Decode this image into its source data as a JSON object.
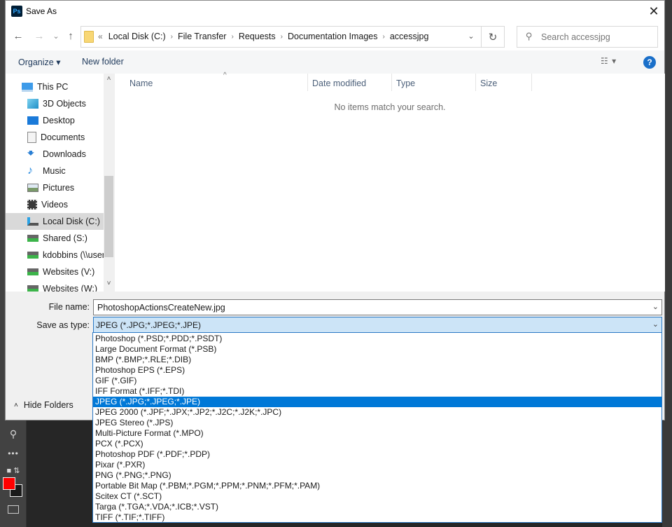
{
  "window": {
    "title": "Save As",
    "app_icon_label": "Ps"
  },
  "nav": {
    "back": "←",
    "forward": "→",
    "recent": "⌄",
    "up": "↑",
    "overflow": "«",
    "breadcrumbs": [
      "Local Disk (C:)",
      "File Transfer",
      "Requests",
      "Documentation Images",
      "accessjpg"
    ],
    "breadcrumb_separator": "›",
    "refresh": "↻",
    "search_placeholder": "Search accessjpg"
  },
  "commandbar": {
    "organize": "Organize ▾",
    "new_folder": "New folder",
    "view_icon": "☷ ▾",
    "help": "?"
  },
  "sidebar": {
    "items": [
      {
        "label": "This PC",
        "icon": "computer-icon",
        "selected": false
      },
      {
        "label": "3D Objects",
        "icon": "cube-icon",
        "selected": false
      },
      {
        "label": "Desktop",
        "icon": "desktop-icon",
        "selected": false
      },
      {
        "label": "Documents",
        "icon": "document-icon",
        "selected": false
      },
      {
        "label": "Downloads",
        "icon": "download-icon",
        "selected": false
      },
      {
        "label": "Music",
        "icon": "music-note-icon",
        "selected": false
      },
      {
        "label": "Pictures",
        "icon": "picture-icon",
        "selected": false
      },
      {
        "label": "Videos",
        "icon": "film-icon",
        "selected": false
      },
      {
        "label": "Local Disk (C:)",
        "icon": "drive-icon",
        "selected": true
      },
      {
        "label": "Shared (S:)",
        "icon": "network-drive-icon",
        "selected": false
      },
      {
        "label": "kdobbins (\\\\user",
        "icon": "network-drive-icon",
        "selected": false
      },
      {
        "label": "Websites (V:)",
        "icon": "network-drive-icon",
        "selected": false
      },
      {
        "label": "Websites (W:)",
        "icon": "network-drive-icon",
        "selected": false
      }
    ],
    "scroll_up": "˄",
    "scroll_down": "˅"
  },
  "file_list": {
    "columns": [
      "Name",
      "Date modified",
      "Type",
      "Size"
    ],
    "sort_indicator": "^",
    "empty_message": "No items match your search."
  },
  "form": {
    "filename_label": "File name:",
    "filename_value": "PhotoshopActionsCreateNew.jpg",
    "type_label": "Save as type:",
    "type_value": "JPEG (*.JPG;*.JPEG;*.JPE)",
    "combo_arrow": "⌄"
  },
  "hide_folders": {
    "chevron": "˄",
    "label": "Hide Folders"
  },
  "type_options": [
    "Photoshop (*.PSD;*.PDD;*.PSDT)",
    "Large Document Format (*.PSB)",
    "BMP (*.BMP;*.RLE;*.DIB)",
    "Photoshop EPS (*.EPS)",
    "GIF (*.GIF)",
    "IFF Format (*.IFF;*.TDI)",
    "JPEG (*.JPG;*.JPEG;*.JPE)",
    "JPEG 2000 (*.JPF;*.JPX;*.JP2;*.J2C;*.J2K;*.JPC)",
    "JPEG Stereo (*.JPS)",
    "Multi-Picture Format (*.MPO)",
    "PCX (*.PCX)",
    "Photoshop PDF (*.PDF;*.PDP)",
    "Pixar (*.PXR)",
    "PNG (*.PNG;*.PNG)",
    "Portable Bit Map (*.PBM;*.PGM;*.PPM;*.PNM;*.PFM;*.PAM)",
    "Scitex CT (*.SCT)",
    "Targa (*.TGA;*.VDA;*.ICB;*.VST)",
    "TIFF (*.TIF;*.TIFF)"
  ],
  "selected_type_index": 6,
  "photoshop": {
    "foreground_color": "#ff0000",
    "background_color": "#1a1a1a"
  },
  "colors": {
    "selection_blue": "#0078d7",
    "combo_focus": "#cce4f7",
    "help_blue": "#1a6fc9"
  }
}
